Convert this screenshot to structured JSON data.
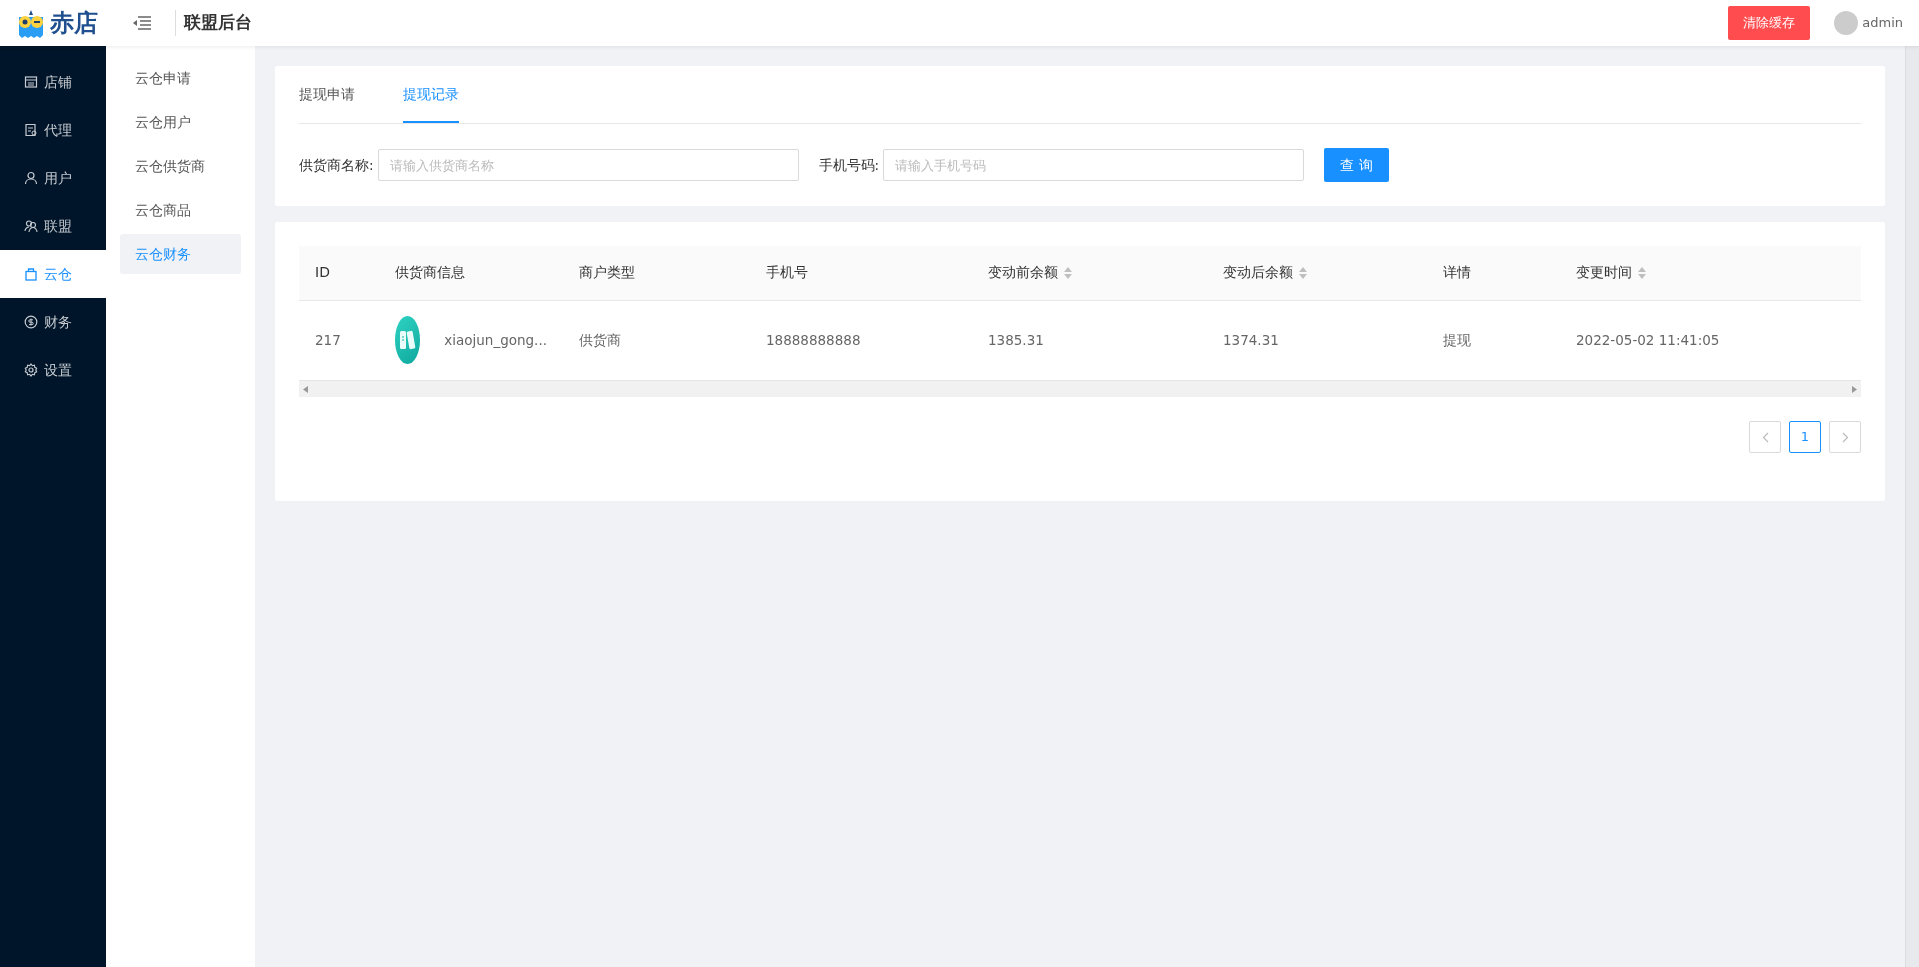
{
  "header": {
    "logo_text": "赤店",
    "title": "联盟后台",
    "clear_button": "清除缓存",
    "user": "admin"
  },
  "sidebar": {
    "items": [
      {
        "label": "店铺",
        "kind": "shop",
        "selected": false
      },
      {
        "label": "代理",
        "kind": "agent",
        "selected": false
      },
      {
        "label": "用户",
        "kind": "user",
        "selected": false
      },
      {
        "label": "联盟",
        "kind": "team",
        "selected": false
      },
      {
        "label": "云仓",
        "kind": "bag",
        "selected": true
      },
      {
        "label": "财务",
        "kind": "coin",
        "selected": false
      },
      {
        "label": "设置",
        "kind": "gear",
        "selected": false
      }
    ]
  },
  "submenu": {
    "items": [
      {
        "label": "云仓申请",
        "selected": false
      },
      {
        "label": "云仓用户",
        "selected": false
      },
      {
        "label": "云仓供货商",
        "selected": false
      },
      {
        "label": "云仓商品",
        "selected": false
      },
      {
        "label": "云仓财务",
        "selected": true
      }
    ]
  },
  "tabs": [
    {
      "label": "提现申请",
      "selected": false
    },
    {
      "label": "提现记录",
      "selected": true
    }
  ],
  "filters": [
    {
      "label": "供货商名称:",
      "placeholder": "请输入供货商名称"
    },
    {
      "label": "手机号码:",
      "placeholder": "请输入手机号码"
    }
  ],
  "search_button": "查 询",
  "table": {
    "columns": [
      {
        "label": "ID",
        "sortable": false
      },
      {
        "label": "供货商信息",
        "sortable": false
      },
      {
        "label": "商户类型",
        "sortable": false
      },
      {
        "label": "手机号",
        "sortable": false
      },
      {
        "label": "变动前余额",
        "sortable": true
      },
      {
        "label": "变动后余额",
        "sortable": true
      },
      {
        "label": "详情",
        "sortable": false
      },
      {
        "label": "变更时间",
        "sortable": true
      }
    ],
    "rows": [
      {
        "cells": [
          "217",
          "xiaojun_gong...",
          "供货商",
          "18888888888",
          "1385.31",
          "1374.31",
          "提现",
          "2022-05-02 11:41:05"
        ]
      }
    ]
  },
  "pagination": {
    "pages": [
      {
        "label": "1",
        "selected": true
      }
    ]
  }
}
